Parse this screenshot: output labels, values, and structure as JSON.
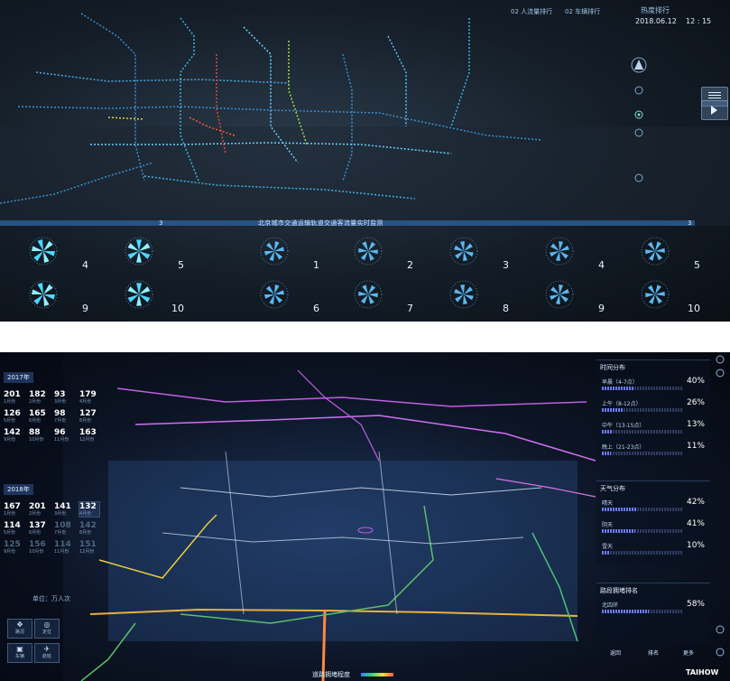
{
  "top": {
    "header_buttons": [
      "02 人流量排行",
      "02 车辆排行",
      "热度排行"
    ],
    "date": "2018.06.12",
    "time": "12 : 15",
    "banner": "北京城市交通运输轨道交通客流量实时监测",
    "banner_left_num": "3",
    "banner_right_num": "3",
    "fan_rows": [
      [
        "4",
        "5",
        "1",
        "2",
        "3",
        "4",
        "5"
      ],
      [
        "9",
        "10",
        "6",
        "7",
        "8",
        "9",
        "10"
      ]
    ]
  },
  "bottom": {
    "year_a": "2017年",
    "grid_a": [
      {
        "v": "201",
        "m": "1月份"
      },
      {
        "v": "182",
        "m": "2月份"
      },
      {
        "v": "93",
        "m": "3月份"
      },
      {
        "v": "179",
        "m": "4月份"
      },
      {
        "v": "126",
        "m": "5月份"
      },
      {
        "v": "165",
        "m": "6月份"
      },
      {
        "v": "98",
        "m": "7月份"
      },
      {
        "v": "127",
        "m": "8月份"
      },
      {
        "v": "142",
        "m": "9月份"
      },
      {
        "v": "88",
        "m": "10月份"
      },
      {
        "v": "96",
        "m": "11月份"
      },
      {
        "v": "163",
        "m": "12月份"
      }
    ],
    "year_b": "2018年",
    "grid_b": [
      {
        "v": "167",
        "m": "1月份"
      },
      {
        "v": "201",
        "m": "2月份"
      },
      {
        "v": "141",
        "m": "3月份"
      },
      {
        "v": "132",
        "m": "4月份"
      },
      {
        "v": "114",
        "m": "5月份"
      },
      {
        "v": "137",
        "m": "6月份"
      },
      {
        "v": "108",
        "m": "7月份"
      },
      {
        "v": "142",
        "m": "8月份"
      },
      {
        "v": "125",
        "m": "9月份"
      },
      {
        "v": "156",
        "m": "10月份"
      },
      {
        "v": "114",
        "m": "11月份"
      },
      {
        "v": "151",
        "m": "12月份"
      }
    ],
    "left_note": "单位：万人次",
    "left_buttons": [
      {
        "icon": "✥",
        "label": "路况"
      },
      {
        "icon": "◎",
        "label": "定位"
      },
      {
        "icon": "▣",
        "label": "车辆"
      },
      {
        "icon": "✈",
        "label": "航班"
      }
    ],
    "section_time": {
      "title": "时间分布",
      "rows": [
        {
          "label": "早晨（4-7点）",
          "pct": "40%",
          "fill": 0.4
        },
        {
          "label": "上午（8-12点）",
          "pct": "26%",
          "fill": 0.26
        },
        {
          "label": "中午（13-15点）",
          "pct": "13%",
          "fill": 0.13
        },
        {
          "label": "晚上（21-23点）",
          "pct": "11%",
          "fill": 0.11
        }
      ]
    },
    "section_weather": {
      "title": "天气分布",
      "rows": [
        {
          "label": "晴天",
          "pct": "42%",
          "fill": 0.42
        },
        {
          "label": "阴天",
          "pct": "41%",
          "fill": 0.41
        },
        {
          "label": "雪天",
          "pct": "10%",
          "fill": 0.1
        }
      ]
    },
    "section_road": {
      "title": "路段拥堵排名",
      "rows": [
        {
          "label": "北四环",
          "pct": "58%",
          "fill": 0.58
        }
      ]
    },
    "right_buttons": [
      "返回",
      "排名",
      "更多"
    ],
    "legend_text": "道路拥堵程度",
    "brand": "TAIHOW"
  }
}
